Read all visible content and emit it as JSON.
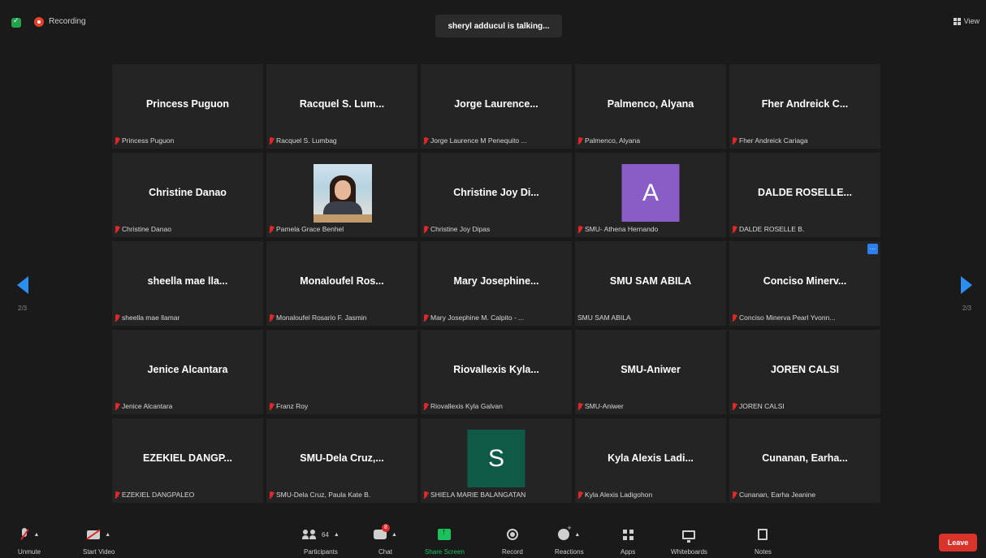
{
  "topbar": {
    "recording_label": "Recording",
    "talking_text": "sheryl adducul is talking...",
    "view_label": "View"
  },
  "pagination": {
    "left": "2/3",
    "right": "2/3"
  },
  "tiles": [
    {
      "name": "Princess Puguon",
      "label": "Princess Puguon",
      "muted": true
    },
    {
      "name": "Racquel S. Lum...",
      "label": "Racquel S. Lumbag",
      "muted": true
    },
    {
      "name": "Jorge Laurence...",
      "label": "Jorge Laurence M Penequito ...",
      "muted": true
    },
    {
      "name": "Palmenco, Alyana",
      "label": "Palmenco, Alyana",
      "muted": true
    },
    {
      "name": "Fher Andreick C...",
      "label": "Fher Andreick Cariaga",
      "muted": true
    },
    {
      "name": "Christine Danao",
      "label": "Christine Danao",
      "muted": true
    },
    {
      "name": "",
      "label": "Pamela Grace Benhel",
      "muted": true,
      "video": true
    },
    {
      "name": "Christine Joy Di...",
      "label": "Christine Joy Dipas",
      "muted": true
    },
    {
      "name": "",
      "label": "SMU- Athena Hernando",
      "muted": true,
      "avatar_letter": "A",
      "avatar_color": "#8a5cc7"
    },
    {
      "name": "DALDE ROSELLE...",
      "label": "DALDE ROSELLE B.",
      "muted": true
    },
    {
      "name": "sheella mae lla...",
      "label": "sheella mae llamar",
      "muted": true
    },
    {
      "name": "Monaloufel Ros...",
      "label": "Monaloufel Rosario F. Jasmin",
      "muted": true
    },
    {
      "name": "Mary Josephine...",
      "label": "Mary Josephine M. Calpito - ...",
      "muted": true
    },
    {
      "name": "SMU SAM ABILA",
      "label": "SMU SAM ABILA",
      "muted": false
    },
    {
      "name": "Conciso Minerv...",
      "label": "Conciso Minerva Pearl Yvonn...",
      "muted": true,
      "more": true
    },
    {
      "name": "Jenice Alcantara",
      "label": "Jenice Alcantara",
      "muted": true
    },
    {
      "name": "",
      "label": "Franz Roy",
      "muted": true
    },
    {
      "name": "Riovallexis Kyla...",
      "label": "Riovallexis Kyla Galvan",
      "muted": true
    },
    {
      "name": "SMU-Aniwer",
      "label": "SMU-Aniwer",
      "muted": true
    },
    {
      "name": "JOREN CALSI",
      "label": "JOREN CALSI",
      "muted": true
    },
    {
      "name": "EZEKIEL DANGP...",
      "label": "EZEKIEL DANGPALEO",
      "muted": true
    },
    {
      "name": "SMU-Dela Cruz,...",
      "label": "SMU-Dela Cruz, Paula Kate B.",
      "muted": true
    },
    {
      "name": "",
      "label": "SHIELA MARIE BALANGATAN",
      "muted": true,
      "avatar_letter": "S",
      "avatar_color": "#0e5a47"
    },
    {
      "name": "Kyla Alexis Ladi...",
      "label": "Kyla Alexis Ladigohon",
      "muted": true
    },
    {
      "name": "Cunanan, Earha...",
      "label": "Cunanan, Earha Jeanine",
      "muted": true
    }
  ],
  "toolbar": {
    "unmute": "Unmute",
    "start_video": "Start Video",
    "participants": "Participants",
    "participants_count": "64",
    "chat": "Chat",
    "chat_badge": "8",
    "share_screen": "Share Screen",
    "record": "Record",
    "reactions": "Reactions",
    "apps": "Apps",
    "whiteboards": "Whiteboards",
    "notes": "Notes",
    "leave": "Leave"
  },
  "colors": {
    "accent": "#2b8ff0",
    "share_green": "#19c25c",
    "leave_red": "#d9342b",
    "mute_red": "#e02828"
  }
}
